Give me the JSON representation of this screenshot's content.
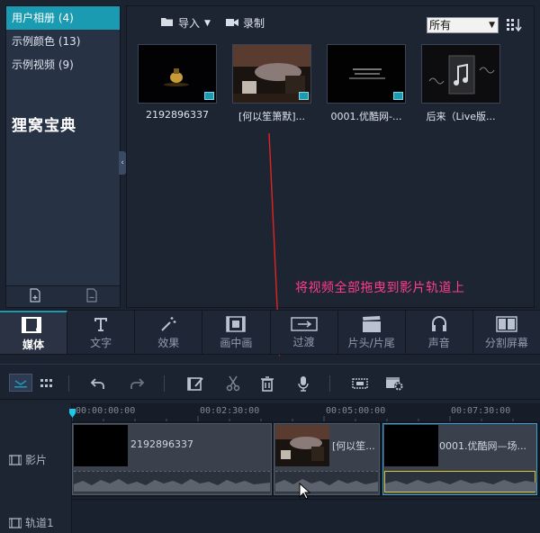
{
  "library": {
    "items": [
      {
        "label": "用户相册 (4)",
        "active": true
      },
      {
        "label": "示例颜色 (13)",
        "active": false
      },
      {
        "label": "示例视频 (9)",
        "active": false
      }
    ],
    "brand_text": "狸窝宝典"
  },
  "media_toolbar": {
    "import_label": "导入",
    "record_label": "录制",
    "sort_value": "所有"
  },
  "thumbnails": [
    {
      "caption": "2192896337"
    },
    {
      "caption": "[何以笙箫默]..."
    },
    {
      "caption": "0001.优酷网-..."
    },
    {
      "caption": "后来（Live版..."
    }
  ],
  "drag_hint": "将视频全部拖曳到影片轨道上",
  "categories": [
    {
      "label": "媒体",
      "icon": "media-icon",
      "active": true
    },
    {
      "label": "文字",
      "icon": "text-icon",
      "active": false
    },
    {
      "label": "效果",
      "icon": "effects-wand-icon",
      "active": false
    },
    {
      "label": "画中画",
      "icon": "pip-icon",
      "active": false
    },
    {
      "label": "过渡",
      "icon": "transition-icon",
      "active": false
    },
    {
      "label": "片头/片尾",
      "icon": "clapper-icon",
      "active": false
    },
    {
      "label": "声音",
      "icon": "headphones-icon",
      "active": false
    },
    {
      "label": "分割屏幕",
      "icon": "split-screen-icon",
      "active": false
    }
  ],
  "timeline": {
    "ruler_labels": [
      "00:00:00:00",
      "00:02:30:00",
      "00:05:00:00",
      "00:07:30:00"
    ],
    "tracks": {
      "video_label": "影片",
      "track1_label": "轨道1"
    },
    "clips": [
      {
        "label": "2192896337"
      },
      {
        "label": "[何以笙..."
      },
      {
        "label": "0001.优酷网—场..."
      }
    ]
  },
  "colors": {
    "accent": "#1a9bb2",
    "hint": "#ff3c8e",
    "selected_clip": "#3b9fd6"
  }
}
